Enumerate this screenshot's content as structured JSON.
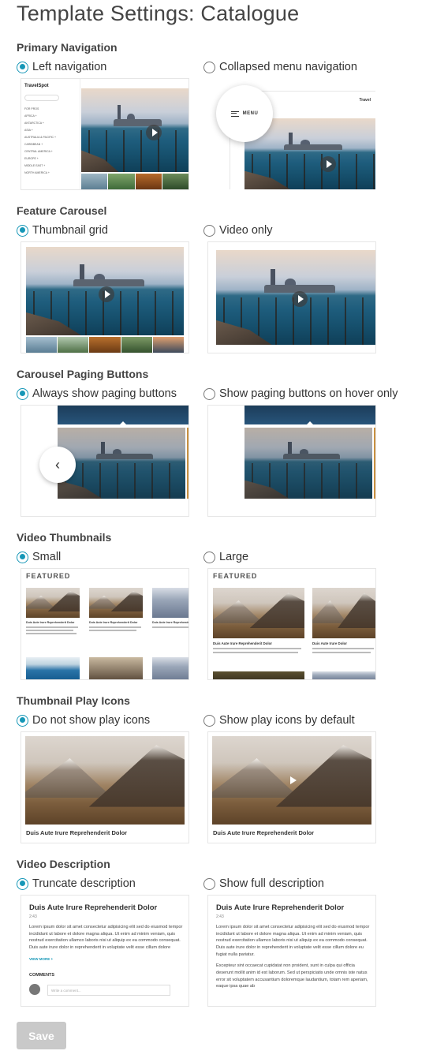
{
  "page": {
    "title": "Template Settings: Catalogue"
  },
  "sections": [
    {
      "title": "Primary Navigation",
      "options": [
        {
          "label": "Left navigation",
          "checked": true
        },
        {
          "label": "Collapsed menu navigation",
          "checked": false
        }
      ]
    },
    {
      "title": "Feature Carousel",
      "options": [
        {
          "label": "Thumbnail grid",
          "checked": true
        },
        {
          "label": "Video only",
          "checked": false
        }
      ]
    },
    {
      "title": "Carousel Paging Buttons",
      "options": [
        {
          "label": "Always show paging buttons",
          "checked": true
        },
        {
          "label": "Show paging buttons on hover only",
          "checked": false
        }
      ]
    },
    {
      "title": "Video Thumbnails",
      "options": [
        {
          "label": "Small",
          "checked": true
        },
        {
          "label": "Large",
          "checked": false
        }
      ]
    },
    {
      "title": "Thumbnail Play Icons",
      "options": [
        {
          "label": "Do not show play icons",
          "checked": true
        },
        {
          "label": "Show play icons by default",
          "checked": false
        }
      ]
    },
    {
      "title": "Video Description",
      "options": [
        {
          "label": "Truncate description",
          "checked": true
        },
        {
          "label": "Show full description",
          "checked": false
        }
      ]
    }
  ],
  "previews": {
    "nav": {
      "brand": "TravelSpot",
      "brand_short": "Travel",
      "search_placeholder": "Search videos",
      "menu_label": "MENU",
      "sidebar_items": [
        "FOR PROS",
        "AFRICA +",
        "ANTARCTICA +",
        "ASIA +",
        "AUSTRALIA & PACIFIC +",
        "CARIBBEAN +",
        "CENTRAL AMERICA +",
        "EUROPE +",
        "MIDDLE EAST +",
        "NORTH AMERICA +"
      ]
    },
    "featured_label": "FEATURED",
    "thumb_title": "Duis Aute Irure Reprehenderit Dolor",
    "thumb_title_short": "Duis Aute Irure Dolor",
    "thumb_duration": "2:43",
    "thumb_text": "Lorem ipsum dolor sit amet consectetur adipisicing elit sed do eiusmod tempor incididunt",
    "description": {
      "title": "Duis Aute Irure Reprehenderit Dolor",
      "time": "2:43",
      "body_truncated": "Lorem ipsum dolor sit amet consectetur adipisicing elit sed do eiusmod tempor incididunt ut labore et dolore magna aliqua. Ut enim ad minim veniam, quis nostrud exercitation ullamco laboris nisi ut aliquip ex ea commodo consequat. Duis aute irure dolor in reprehenderit in voluptate velit esse cillum dolore",
      "body_full_p1": "Lorem ipsum dolor sit amet consectetur adipisicing elit sed do eiusmod tempor incididunt ut labore et dolore magna aliqua. Ut enim ad minim veniam, quis nostrud exercitation ullamco laboris nisi ut aliquip ex ea commodo consequat. Duis aute irure dolor in reprehenderit in voluptate velit esse cillum dolore eu fugiat nulla pariatur.",
      "body_full_p2": "Excepteur sint occaecat cupidatat non proident, sunt in culpa qui officia deserunt mollit anim id est laborum. Sed ut perspiciatis unde omnis iste natus error sit voluptatem accusantium doloremque laudantium, totam rem aperiam, eaque ipsa quae ab",
      "view_more": "VIEW MORE +",
      "comments_label": "COMMENTS",
      "comment_placeholder": "Write a comment..."
    }
  },
  "actions": {
    "save_label": "Save"
  },
  "colors": {
    "accent": "#1697b7",
    "save_disabled": "#c9c9c9"
  }
}
